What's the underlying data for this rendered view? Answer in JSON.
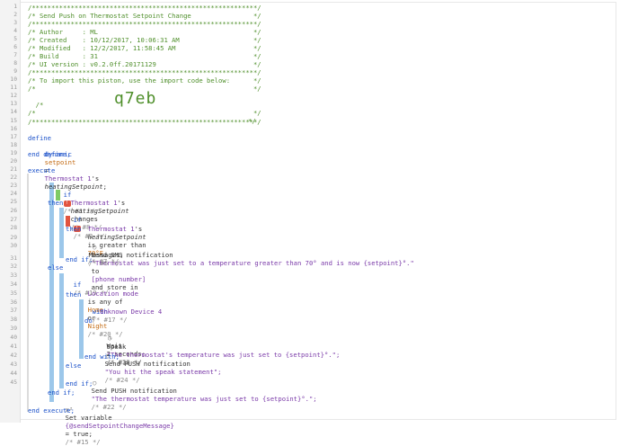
{
  "gutter": {
    "line_numbers": [
      "1",
      "2",
      "3",
      "4",
      "5",
      "6",
      "7",
      "8",
      "9",
      "10",
      "11",
      "12",
      "13",
      "14",
      "15",
      "16",
      "17",
      "18",
      "19",
      "20",
      "21",
      "22",
      "23",
      "24",
      "25",
      "26",
      "27",
      "28",
      "29",
      "30",
      "31",
      "32",
      "33",
      "34",
      "35",
      "36",
      "37",
      "38",
      "39",
      "40",
      "41",
      "42",
      "43",
      "44",
      "45"
    ]
  },
  "code": {
    "l1": "/**********************************************************/",
    "l2": "/* Send Push on Thermostat Setpoint Change                */",
    "l3": "/**********************************************************/",
    "l4": "/* Author     : ML                                        */",
    "l5": "/* Created    : 10/12/2017, 10:06:31 AM                   */",
    "l6": "/* Modified   : 12/2/2017, 11:58:45 AM                    */",
    "l7": "/* Build      : 31                                        */",
    "l8": "/* UI version : v0.2.0ff.20171129                         */",
    "l9": "/**********************************************************/",
    "l10": "/* To import this piston, use the import code below:      */",
    "l11": "/*                                                        */",
    "l12_prefix": "/*",
    "l12_code": "q7eb",
    "l12_suffix": "*/",
    "l13": "/*                                                        */",
    "l14": "/**********************************************************/",
    "l16": "define",
    "l17_kw": "dynamic",
    "l17_var": "setpoint",
    "l17_eq": "=",
    "l17_dev": "Thermostat 1",
    "l17_s": "'s",
    "l17_attr": "heatingSetpoint",
    "l17_end": ";",
    "l18": "end define;",
    "l20": "execute",
    "l21_kw": "if",
    "l21_c": "/* #1 */",
    "l22_dev": "Thermostat 1",
    "l22_s": "'s",
    "l22_attr": "heatingSetpoint",
    "l22_op": "changes",
    "l22_c": "/* #8 */",
    "l23": "then",
    "l24_kw": "if",
    "l24_c": "/* #2 */",
    "l25_dev": "Thermostat 1",
    "l25_s": "'s",
    "l25_attr": "heatingSetpoint",
    "l25_op": "is greater than",
    "l25_val": "70°F",
    "l25_c": "/* #7 */",
    "l26": "then",
    "l27_pre": "Send SMS notification",
    "l27_str": "\"Thermostat was just set to a temperature greater than 70° and is now {setpoint}°.\"",
    "l27_to": "to",
    "l27_ph": "[phone number]",
    "l27_post": "and store in",
    "l28_pre": "Messages;",
    "l28_c": "/* #6 */",
    "l29": "end if;",
    "l30": "else",
    "l31_kw": "if",
    "l31_c": "/* #19 */",
    "l32_a": "Location mode",
    "l32_b": "is any of",
    "l32_c1": "Home",
    "l32_or": "or",
    "l32_c2": "Night",
    "l32_c": "/* #20 */",
    "l33": "then",
    "l34_kw": "with",
    "l34_c": "/* #17 */",
    "l35": "Unknown Device 4",
    "l36": "do",
    "l37_a": "Wait",
    "l37_b": "2 seconds;",
    "l37_c": "/* #23 */",
    "l38_a": "Speak",
    "l38_b": "\"The thermostat's temperature was just set to {setpoint}°.\";",
    "l38_c": "/* #18 */",
    "l39_a": "Send PUSH notification",
    "l39_b": "\"You hit the speak statement\";",
    "l39_c": "/* #24 */",
    "l40": "end with;",
    "l41": "else",
    "l42_a": "Send PUSH notification",
    "l42_b": "\"The thermostat temperature was just set to {setpoint}°.\";",
    "l42_c": "/* #22 */",
    "l43": "end if;",
    "l44": "end if;",
    "l45_a": "Set variable",
    "l45_b": "{@sendSetpointChangeMessage}",
    "l45_c": "= true;",
    "l45_d": "/* #15 */",
    "l46": "end execute;"
  },
  "colors": {
    "comment": "#8a8a8a",
    "header_green": "#4f8f2b",
    "keyword": "#1a50c9",
    "device": "#7a3aa8",
    "variable": "#c36a12",
    "bar_blue": "#9cc7ea",
    "bar_green": "#7ecb63",
    "marker_red": "#e2543f"
  },
  "icons": [
    "warning-icon",
    "notification-icon",
    "clock-icon",
    "variable-icon"
  ]
}
